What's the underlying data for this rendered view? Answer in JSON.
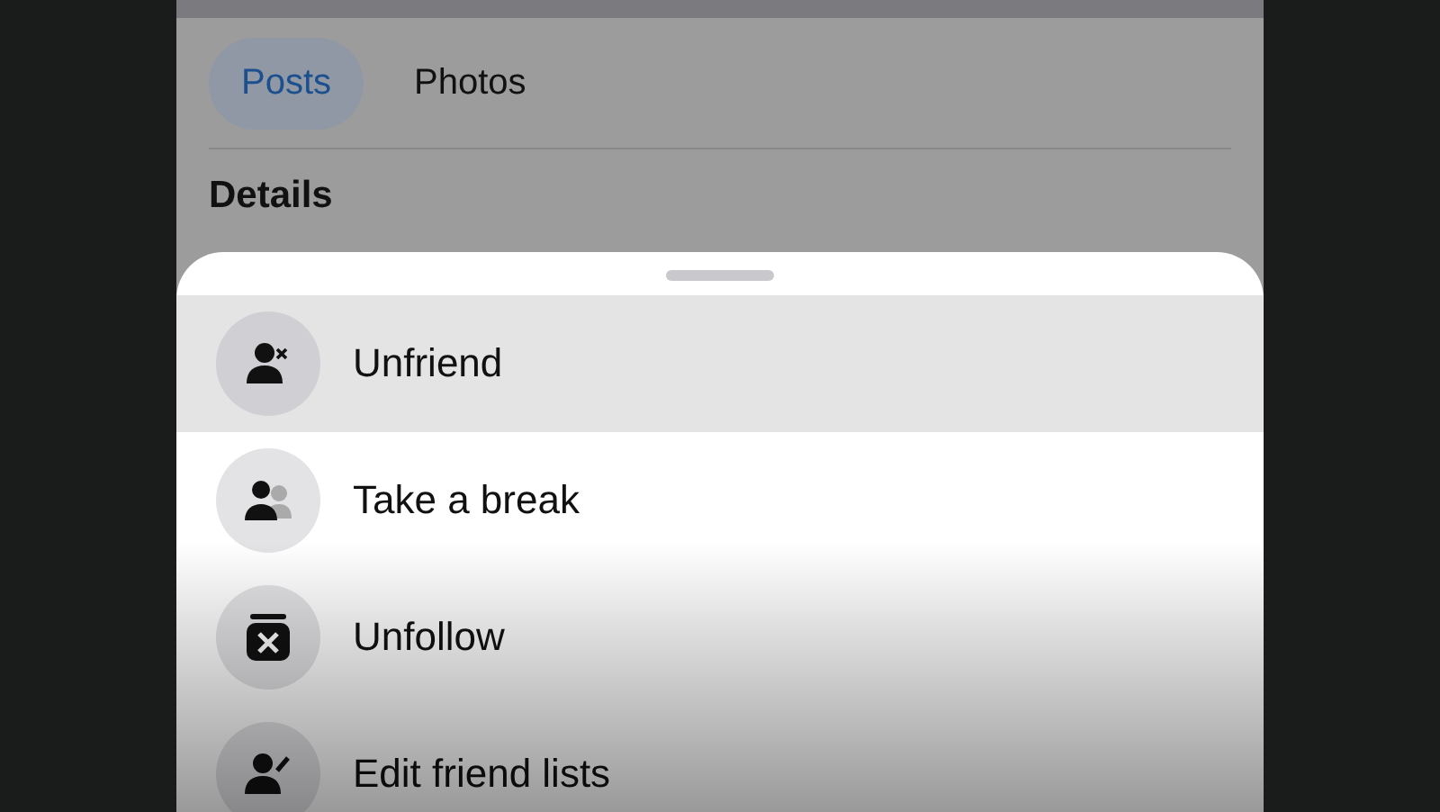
{
  "tabs": [
    {
      "label": "Posts",
      "selected": true
    },
    {
      "label": "Photos",
      "selected": false
    }
  ],
  "section_title": "Details",
  "menu": {
    "items": [
      {
        "kind": "unfriend",
        "label": "Unfriend",
        "selected": true
      },
      {
        "kind": "break",
        "label": "Take a break",
        "selected": false
      },
      {
        "kind": "unfollow",
        "label": "Unfollow",
        "selected": false
      },
      {
        "kind": "edit",
        "label": "Edit friend lists",
        "selected": false
      }
    ]
  }
}
